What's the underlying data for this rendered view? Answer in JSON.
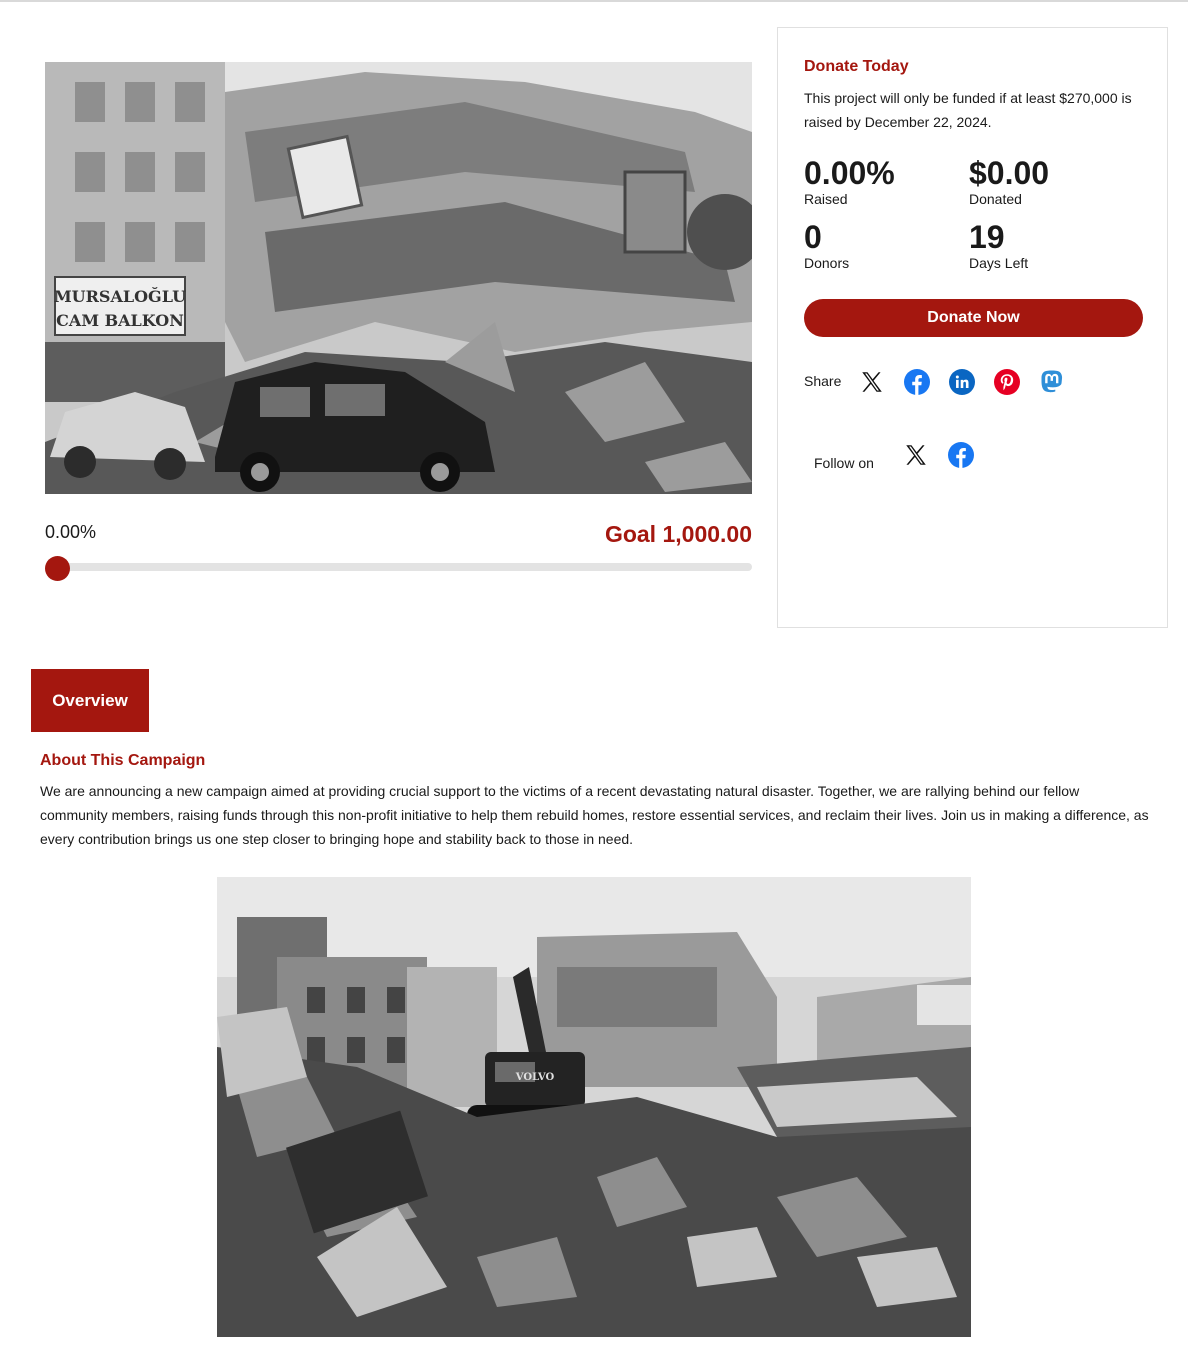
{
  "hero_image": {
    "alt": "Collapsed building after earthquake",
    "sign_text_1": "MURSALOĞLU",
    "sign_text_2": "CAM BALKON"
  },
  "progress": {
    "percent_label": "0.00%",
    "fraction": 0.0,
    "goal_label": "Goal 1,000.00"
  },
  "donate_card": {
    "title": "Donate Today",
    "description": "This project will only be funded if at least $270,000 is raised by December 22, 2024.",
    "stats": [
      {
        "value": "0.00%",
        "label": "Raised"
      },
      {
        "value": "$0.00",
        "label": "Donated"
      },
      {
        "value": "0",
        "label": "Donors"
      },
      {
        "value": "19",
        "label": "Days Left"
      }
    ],
    "donate_button": "Donate Now",
    "share_label": "Share",
    "share_icons": [
      "x-icon",
      "facebook-icon",
      "linkedin-icon",
      "pinterest-icon",
      "mastodon-icon"
    ],
    "follow_label": "Follow on",
    "follow_icons": [
      "x-icon",
      "facebook-icon"
    ]
  },
  "tabs": [
    {
      "label": "Overview",
      "active": true
    }
  ],
  "about": {
    "title": "About This Campaign",
    "body": "We are announcing a new campaign aimed at providing crucial support to the victims of a recent devastating natural disaster. Together, we are rallying behind our fellow community members, raising funds through this non-profit initiative to help them rebuild homes, restore essential services, and reclaim their lives. Join us in making a difference, as every contribution brings us one step closer to bringing hope and stability back to those in need."
  },
  "second_image": {
    "alt": "Excavator clearing earthquake rubble",
    "excavator_text": "VOLVO"
  },
  "colors": {
    "accent": "#a4170f",
    "facebook": "#1877f2",
    "linkedin": "#0a66c2",
    "pinterest": "#e60023",
    "mastodon": "#2f8fd8"
  }
}
